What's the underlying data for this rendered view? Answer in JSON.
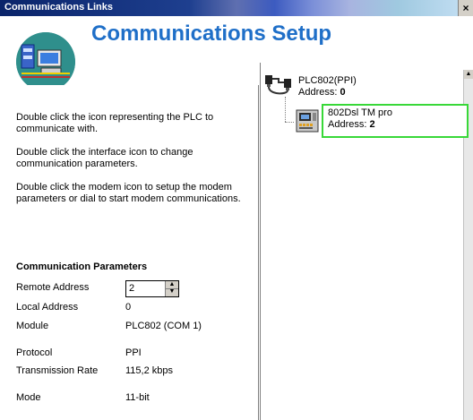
{
  "window": {
    "title": "Communications Links",
    "close_label": "×"
  },
  "heading": "Communications Setup",
  "instructions": [
    "Double click the icon representing the PLC to communicate with.",
    "Double click the interface icon to change communication parameters.",
    "Double click the modem icon to setup the modem parameters or dial to start modem communications."
  ],
  "params": {
    "title": "Communication Parameters",
    "remote_address_label": "Remote Address",
    "remote_address_value": "2",
    "local_address_label": "Local Address",
    "local_address_value": "0",
    "module_label": "Module",
    "module_value": "PLC802 (COM 1)",
    "protocol_label": "Protocol",
    "protocol_value": "PPI",
    "rate_label": "Transmission Rate",
    "rate_value": "115,2 kbps",
    "mode_label": "Mode",
    "mode_value": "11-bit"
  },
  "tree": {
    "root": {
      "name": "PLC802(PPI)",
      "address_label": "Address:",
      "address_value": "0"
    },
    "child": {
      "name": "802Dsl TM pro",
      "address_label": "Address:",
      "address_value": "2"
    }
  }
}
